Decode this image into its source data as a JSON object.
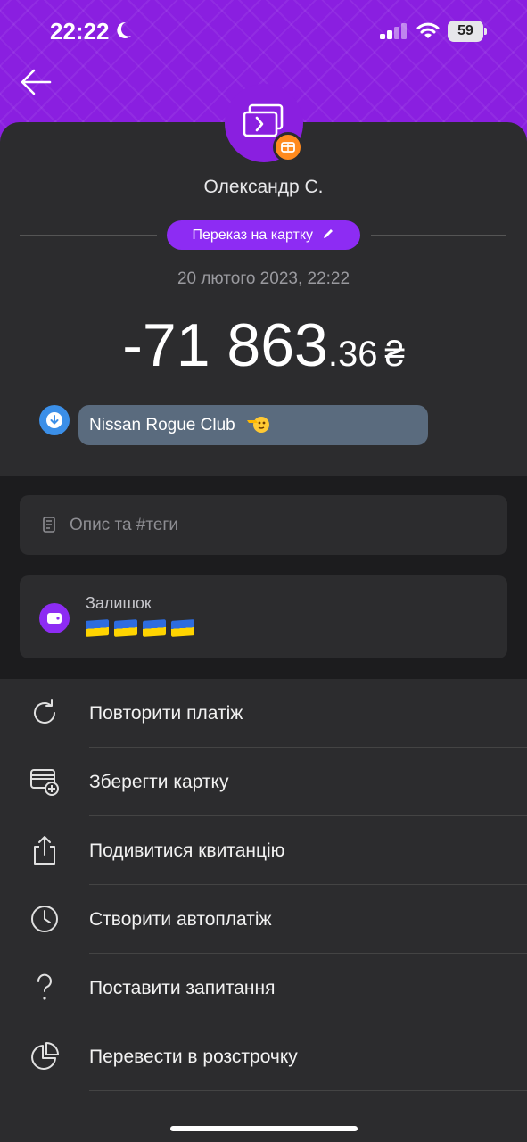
{
  "status_bar": {
    "time": "22:22",
    "battery": "59"
  },
  "recipient": {
    "name": "Олександр С."
  },
  "transfer_type": {
    "label": "Переказ на картку"
  },
  "transaction": {
    "datetime": "20 лютого 2023, 22:22",
    "amount_main": "-71 863",
    "amount_cents": ".36",
    "currency": "₴"
  },
  "message": {
    "text": "Nissan Rogue Club"
  },
  "description": {
    "placeholder": "Опис та #теги"
  },
  "balance": {
    "label": "Залишок",
    "flag_count": 4
  },
  "actions": [
    {
      "label": "Повторити платіж",
      "icon": "repeat-icon"
    },
    {
      "label": "Зберегти картку",
      "icon": "card-add-icon"
    },
    {
      "label": "Подивитися квитанцію",
      "icon": "share-icon"
    },
    {
      "label": "Створити автоплатіж",
      "icon": "clock-icon"
    },
    {
      "label": "Поставити запитання",
      "icon": "question-icon"
    },
    {
      "label": "Перевести в розстрочку",
      "icon": "pie-chart-icon"
    }
  ],
  "colors": {
    "brand": "#8a1fe0",
    "pill": "#8d2cf3",
    "badge": "#ff8a1d",
    "message_icon": "#3b8fe8",
    "sheet": "#2c2c2e",
    "background": "#1c1c1e"
  }
}
